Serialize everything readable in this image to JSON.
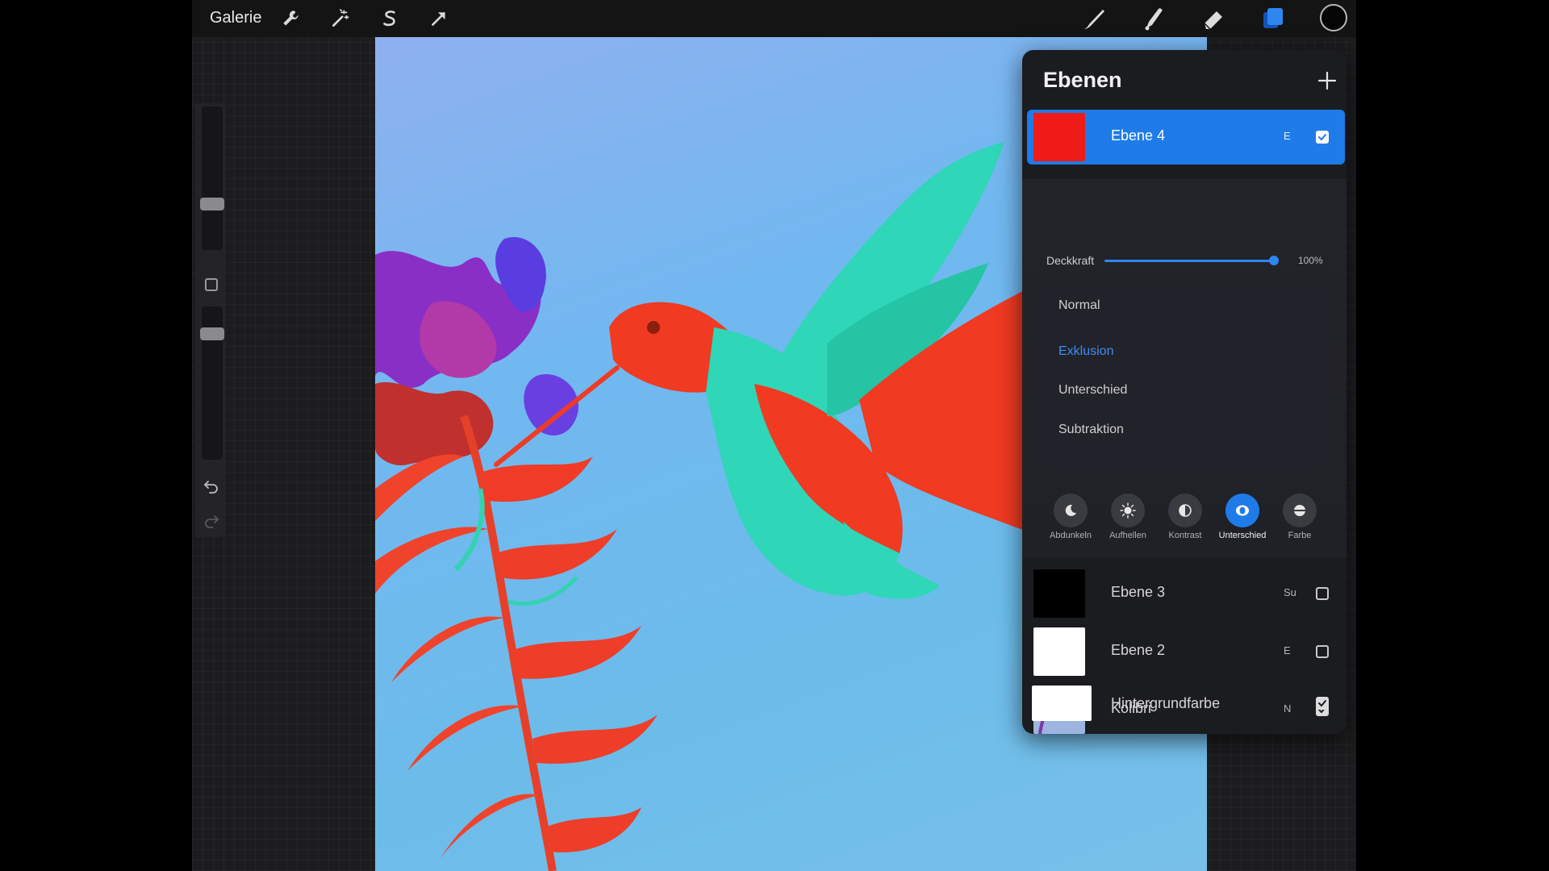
{
  "topbar": {
    "gallery_label": "Galerie",
    "left_tools": [
      "wrench-icon",
      "magic-wand-icon",
      "selection-s-icon",
      "transform-arrow-icon"
    ],
    "right_tools": [
      "brush-icon",
      "smudge-icon",
      "eraser-icon",
      "layers-icon"
    ],
    "active_tool": "layers-icon",
    "current_color": "#050505"
  },
  "sidebar": {
    "brush_size_level": 0.32,
    "opacity_level": 0.82
  },
  "layers_panel": {
    "title": "Ebenen",
    "add_label": "+",
    "active_layer": {
      "name": "Ebene 4",
      "blend_letter": "E",
      "visible": true,
      "thumb_color": "#ee1b18"
    },
    "opacity": {
      "label": "Deckkraft",
      "value_text": "100%",
      "value": 1.0
    },
    "blend_modes": [
      {
        "label": "Normal",
        "selected": false
      },
      {
        "label": "Exklusion",
        "selected": true
      },
      {
        "label": "Unterschied",
        "selected": false
      },
      {
        "label": "Subtraktion",
        "selected": false
      }
    ],
    "mode_groups": [
      {
        "label": "Abdunkeln",
        "icon": "moon-icon",
        "active": false
      },
      {
        "label": "Aufhellen",
        "icon": "sun-icon",
        "active": false
      },
      {
        "label": "Kontrast",
        "icon": "contrast-icon",
        "active": false
      },
      {
        "label": "Unterschied",
        "icon": "difference-icon",
        "active": true
      },
      {
        "label": "Farbe",
        "icon": "color-icon",
        "active": false
      }
    ],
    "layers": [
      {
        "name": "Ebene 3",
        "blend_letter": "Su",
        "visible": false,
        "thumb_color": "#000000"
      },
      {
        "name": "Ebene 2",
        "blend_letter": "E",
        "visible": false,
        "thumb_color": "#ffffff"
      },
      {
        "name": "Kolibri",
        "blend_letter": "N",
        "visible": true,
        "thumb_color": "#8ea7d8"
      },
      {
        "name": "Hintergrundfarbe",
        "blend_letter": "",
        "visible": true,
        "thumb_color": "#ffffff"
      }
    ]
  },
  "colors": {
    "accent": "#1f7be8",
    "panel_bg": "#1b1c20",
    "canvas_sky": "#6cbcea",
    "bird_red": "#f03a22",
    "bird_teal": "#2fd6b8"
  }
}
